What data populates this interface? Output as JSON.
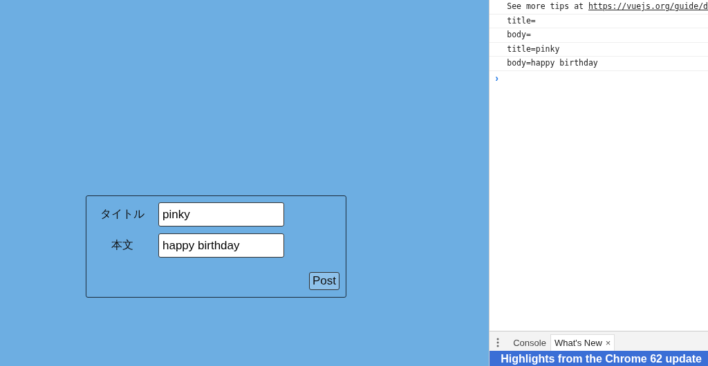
{
  "form": {
    "fields": [
      {
        "label": "タイトル",
        "value": "pinky"
      },
      {
        "label": "本文",
        "value": "happy birthday"
      }
    ],
    "submit": "Post"
  },
  "console": {
    "lines": [
      {
        "kind": "tip",
        "text": "See more tips at ",
        "link": "https://vuejs.org/guide/d"
      },
      {
        "kind": "log",
        "text": "title="
      },
      {
        "kind": "log",
        "text": "body="
      },
      {
        "kind": "log",
        "text": "title=pinky"
      },
      {
        "kind": "log",
        "text": "body=happy birthday"
      }
    ],
    "prompt": "›"
  },
  "drawer": {
    "tabs": [
      {
        "label": "Console",
        "selected": false,
        "closable": false
      },
      {
        "label": "What's New",
        "selected": true,
        "closable": true
      }
    ],
    "close": "×",
    "banner": "Highlights from the Chrome 62 update"
  }
}
